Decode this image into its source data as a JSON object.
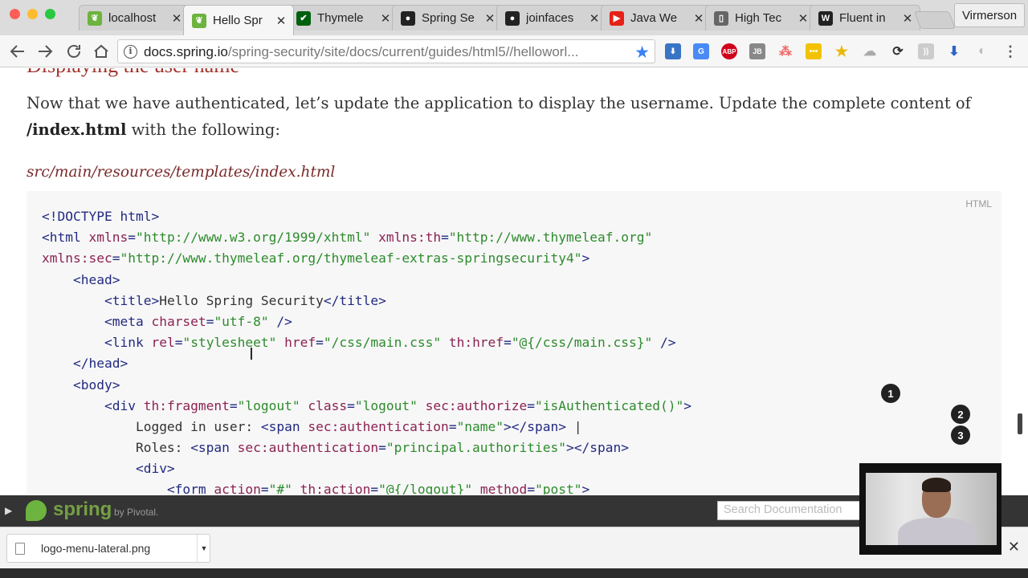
{
  "browser": {
    "tabs": [
      {
        "title": "localhost",
        "icon": "spring-leaf-icon",
        "color": "#6db33f",
        "active": false
      },
      {
        "title": "Hello Spr",
        "icon": "spring-leaf-icon",
        "color": "#6db33f",
        "active": true
      },
      {
        "title": "Thymele",
        "icon": "thymeleaf-icon",
        "color": "#005f0f",
        "active": false
      },
      {
        "title": "Spring Se",
        "icon": "github-icon",
        "color": "#222222",
        "active": false
      },
      {
        "title": "joinfaces",
        "icon": "github-icon",
        "color": "#222222",
        "active": false
      },
      {
        "title": "Java We",
        "icon": "youtube-icon",
        "color": "#e62117",
        "active": false
      },
      {
        "title": "High Tec",
        "icon": "document-icon",
        "color": "#666666",
        "active": false
      },
      {
        "title": "Fluent in",
        "icon": "wikipedia-icon",
        "color": "#222222",
        "active": false
      }
    ],
    "profile_name": "Virmerson",
    "url_host": "docs.spring.io",
    "url_path": "/spring-security/site/docs/current/guides/html5//helloworl..."
  },
  "page": {
    "section_heading": "Displaying the user name",
    "paragraph_before": "Now that we have authenticated, let’s update the application to display the username. Update the complete content of ",
    "paragraph_bold": "/index.html",
    "paragraph_after": " with the following:",
    "file_title": "src/main/resources/templates/index.html",
    "code_language": "HTML",
    "code_lines": [
      {
        "indent": 0,
        "tokens": [
          {
            "k": "t",
            "s": "<!DOCTYPE html>"
          }
        ]
      },
      {
        "indent": 0,
        "tokens": [
          {
            "k": "t",
            "s": "<html "
          },
          {
            "k": "a",
            "s": "xmlns"
          },
          {
            "k": "t",
            "s": "="
          },
          {
            "k": "v",
            "s": "\"http://www.w3.org/1999/xhtml\""
          },
          {
            "k": "t",
            "s": " "
          },
          {
            "k": "a",
            "s": "xmlns:th"
          },
          {
            "k": "t",
            "s": "="
          },
          {
            "k": "v",
            "s": "\"http://www.thymeleaf.org\""
          }
        ]
      },
      {
        "indent": 0,
        "tokens": [
          {
            "k": "a",
            "s": "xmlns:sec"
          },
          {
            "k": "t",
            "s": "="
          },
          {
            "k": "v",
            "s": "\"http://www.thymeleaf.org/thymeleaf-extras-springsecurity4\""
          },
          {
            "k": "t",
            "s": ">"
          }
        ]
      },
      {
        "indent": 4,
        "tokens": [
          {
            "k": "t",
            "s": "<head>"
          }
        ]
      },
      {
        "indent": 8,
        "tokens": [
          {
            "k": "t",
            "s": "<title>"
          },
          {
            "k": "txt",
            "s": "Hello Spring Security"
          },
          {
            "k": "t",
            "s": "</title>"
          }
        ]
      },
      {
        "indent": 8,
        "tokens": [
          {
            "k": "t",
            "s": "<meta "
          },
          {
            "k": "a",
            "s": "charset"
          },
          {
            "k": "t",
            "s": "="
          },
          {
            "k": "v",
            "s": "\"utf-8\""
          },
          {
            "k": "t",
            "s": " />"
          }
        ]
      },
      {
        "indent": 8,
        "tokens": [
          {
            "k": "t",
            "s": "<link "
          },
          {
            "k": "a",
            "s": "rel"
          },
          {
            "k": "t",
            "s": "="
          },
          {
            "k": "v",
            "s": "\"stylesheet\""
          },
          {
            "k": "t",
            "s": " "
          },
          {
            "k": "a",
            "s": "href"
          },
          {
            "k": "t",
            "s": "="
          },
          {
            "k": "v",
            "s": "\"/css/main.css\""
          },
          {
            "k": "t",
            "s": " "
          },
          {
            "k": "a",
            "s": "th:href"
          },
          {
            "k": "t",
            "s": "="
          },
          {
            "k": "v",
            "s": "\"@{/css/main.css}\""
          },
          {
            "k": "t",
            "s": " />"
          }
        ]
      },
      {
        "indent": 4,
        "tokens": [
          {
            "k": "t",
            "s": "</head>"
          }
        ]
      },
      {
        "indent": 4,
        "tokens": [
          {
            "k": "t",
            "s": "<body>"
          }
        ]
      },
      {
        "indent": 8,
        "tokens": [
          {
            "k": "t",
            "s": "<div "
          },
          {
            "k": "a",
            "s": "th:fragment"
          },
          {
            "k": "t",
            "s": "="
          },
          {
            "k": "v",
            "s": "\"logout\""
          },
          {
            "k": "t",
            "s": " "
          },
          {
            "k": "a",
            "s": "class"
          },
          {
            "k": "t",
            "s": "="
          },
          {
            "k": "v",
            "s": "\"logout\""
          },
          {
            "k": "t",
            "s": " "
          },
          {
            "k": "a",
            "s": "sec:authorize"
          },
          {
            "k": "t",
            "s": "="
          },
          {
            "k": "v",
            "s": "\"isAuthenticated()\""
          },
          {
            "k": "t",
            "s": ">"
          }
        ]
      },
      {
        "indent": 12,
        "tokens": [
          {
            "k": "txt",
            "s": "Logged in user: "
          },
          {
            "k": "t",
            "s": "<span "
          },
          {
            "k": "a",
            "s": "sec:authentication"
          },
          {
            "k": "t",
            "s": "="
          },
          {
            "k": "v",
            "s": "\"name\""
          },
          {
            "k": "t",
            "s": "></span>"
          },
          {
            "k": "txt",
            "s": " |"
          }
        ]
      },
      {
        "indent": 12,
        "tokens": [
          {
            "k": "txt",
            "s": "Roles: "
          },
          {
            "k": "t",
            "s": "<span "
          },
          {
            "k": "a",
            "s": "sec:authentication"
          },
          {
            "k": "t",
            "s": "="
          },
          {
            "k": "v",
            "s": "\"principal.authorities\""
          },
          {
            "k": "t",
            "s": "></span>"
          }
        ]
      },
      {
        "indent": 12,
        "tokens": [
          {
            "k": "t",
            "s": "<div>"
          }
        ]
      },
      {
        "indent": 16,
        "tokens": [
          {
            "k": "t",
            "s": "<form "
          },
          {
            "k": "a",
            "s": "action"
          },
          {
            "k": "t",
            "s": "="
          },
          {
            "k": "v",
            "s": "\"#\""
          },
          {
            "k": "t",
            "s": " "
          },
          {
            "k": "a",
            "s": "th:action"
          },
          {
            "k": "t",
            "s": "="
          },
          {
            "k": "v",
            "s": "\"@{/logout}\""
          },
          {
            "k": "t",
            "s": " "
          },
          {
            "k": "a",
            "s": "method"
          },
          {
            "k": "t",
            "s": "="
          },
          {
            "k": "v",
            "s": "\"post\""
          },
          {
            "k": "t",
            "s": ">"
          }
        ]
      }
    ],
    "callouts": [
      "1",
      "2",
      "3"
    ]
  },
  "spring_bar": {
    "brand": "spring",
    "byline": "by Pivotal.",
    "search_placeholder": "Search Documentation"
  },
  "downloads": {
    "file_name": "logo-menu-lateral.png"
  }
}
